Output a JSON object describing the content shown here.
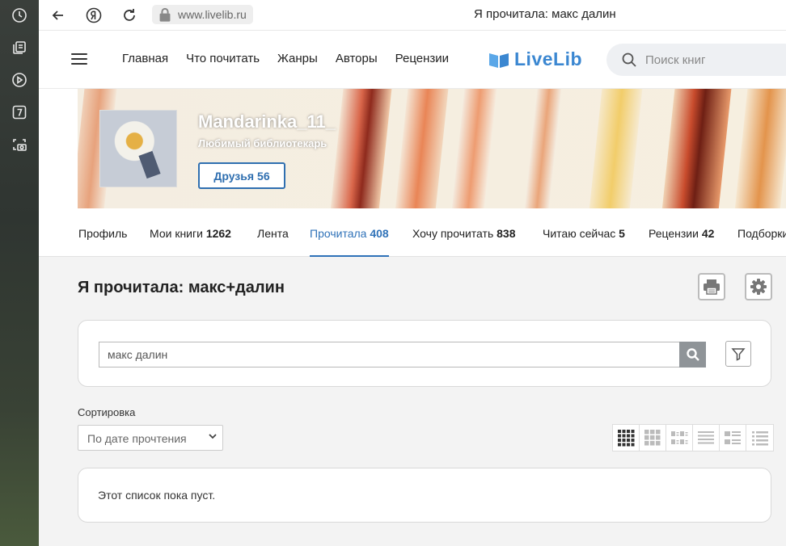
{
  "browser": {
    "url": "www.livelib.ru",
    "tab_title": "Я прочитала: макс далин"
  },
  "site": {
    "nav": [
      "Главная",
      "Что почитать",
      "Жанры",
      "Авторы",
      "Рецензии"
    ],
    "logo_text": "LiveLib",
    "search_placeholder": "Поиск книг"
  },
  "profile": {
    "username": "Mandarinka_11_",
    "status": "Любимый библиотекарь",
    "friends_label": "Друзья",
    "friends_count": "56"
  },
  "tabs": [
    {
      "label": "Профиль",
      "count": ""
    },
    {
      "label": "Мои книги",
      "count": "1262"
    },
    {
      "label": "Лента",
      "count": ""
    },
    {
      "label": "Прочитала",
      "count": "408",
      "active": true
    },
    {
      "label": "Хочу прочитать",
      "count": "838"
    },
    {
      "label": "Читаю сейчас",
      "count": "5"
    },
    {
      "label": "Рецензии",
      "count": "42"
    },
    {
      "label": "Подборки",
      "count": ""
    }
  ],
  "main": {
    "title": "Я прочитала: макс+далин",
    "search_value": "макс далин",
    "sort_label": "Сортировка",
    "sort_value": "По дате прочтения",
    "empty_text": "Этот список пока пуст."
  },
  "colors": {
    "accent": "#2f72b8",
    "logo": "#3b87d1"
  }
}
